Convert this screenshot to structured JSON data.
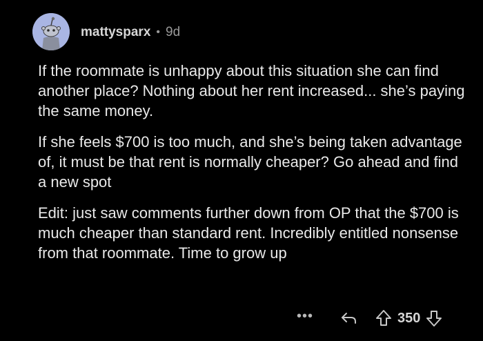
{
  "comment": {
    "username": "mattysparx",
    "separator": "•",
    "age": "9d",
    "paragraphs": [
      "If the roommate is unhappy about this situation she can find another place? Nothing about her rent increased... she’s paying the same money.",
      "If she feels $700 is too much, and she’s being taken advantage of, it must be that rent is normally cheaper? Go ahead and find a new spot",
      "Edit: just saw comments further down from OP that the $700 is much cheaper than standard rent. Incredibly entitled nonsense from that roommate. Time to grow up"
    ],
    "actions": {
      "more": "•••",
      "score": "350"
    }
  },
  "icons": {
    "avatar": "reddit-snoo-avatar",
    "more": "more-icon",
    "reply": "reply-icon",
    "upvote": "upvote-icon",
    "downvote": "downvote-icon"
  },
  "colors": {
    "background": "#000000",
    "text": "#e9e9e9",
    "muted": "#9a9a9a",
    "avatar_bg": "#a9b5e3"
  }
}
